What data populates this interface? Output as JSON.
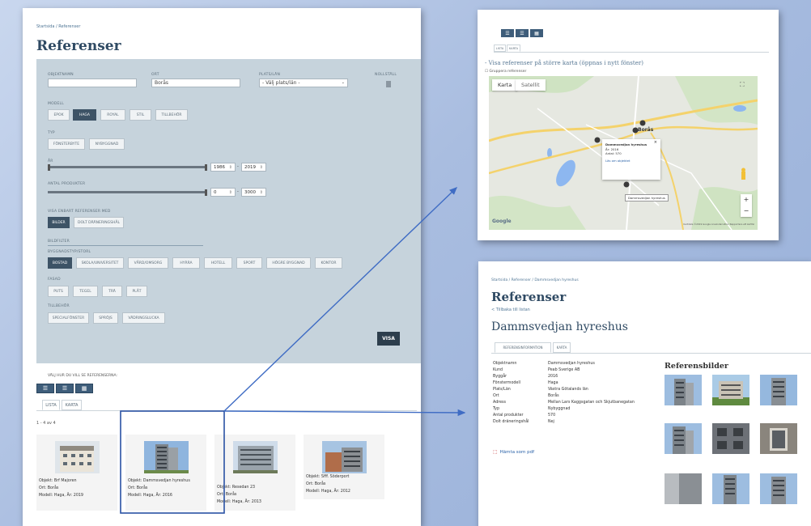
{
  "left": {
    "breadcrumb": "Startsida / Referenser",
    "title": "Referenser",
    "filter": {
      "objektnamn_label": "OBJEKTNAMN",
      "objektnamn_value": "",
      "ort_label": "ORT",
      "ort_value": "Borås",
      "plats_label": "PLATS/LÄN",
      "plats_value": "- Välj plats/län -",
      "nollstall_label": "NOLLSTÄLL",
      "modell_label": "MODELL",
      "modell": [
        "EPOK",
        "HAGA",
        "ROYAL",
        "STIL",
        "TILLBEHÖR"
      ],
      "typ_label": "TYP",
      "typ": [
        "FÖNSTERBYTE",
        "NYBYGGNAD"
      ],
      "ar_label": "ÅR",
      "ar_from": "1986",
      "ar_to": "2019",
      "antal_label": "ANTAL PRODUKTER",
      "antal_from": "0",
      "antal_to": "3000",
      "visa_enbart_label": "VISA ENBART REFERENSER MED",
      "visa_enbart": [
        "BILDER",
        "DOLT DRÄNERINGSHÅL"
      ],
      "bildfilter_label": "BILDFILTER",
      "byggnadsstorlek_label": "BYGGNADSTYP/STORL",
      "byggnadstyp": [
        "BOSTAD",
        "SKOLA/UNIVERSITET",
        "VÅRD/OMSORG",
        "HYRRA",
        "HOTELL",
        "SPORT",
        "HÖGRE BYGGNAD",
        "KONTOR"
      ],
      "fasad_label": "FASAD",
      "fasad": [
        "PUTS",
        "TEGEL",
        "TRÄ",
        "PLÅT"
      ],
      "tillbehor_label": "TILLBEHÖR",
      "tillbehor": [
        "SPECIALFÖNSTER",
        "SPRÖJS",
        "VÄDRINGSLUCKA"
      ],
      "visa_button": "VISA"
    },
    "view_label": "VÄLJ HUR DU VILL SE REFERENSERNA:",
    "tabs": [
      "LISTA",
      "KARTA"
    ],
    "count": "1 - 4 av 4",
    "cards": [
      {
        "objekt": "Objekt: Brf Majoren",
        "ort": "Ort: Borås",
        "modell": "Modell: Haga, År: 2019"
      },
      {
        "objekt": "Objekt: Dammsvedjan hyreshus",
        "ort": "Ort: Borås",
        "modell": "Modell: Haga, År: 2016"
      },
      {
        "objekt": "Objekt: Resedan 23",
        "ort": "Ort: Borås",
        "modell": "Modell: Haga, År: 2013"
      },
      {
        "objekt": "Objekt: Sfff. Söderport",
        "ort": "Ort: Borås",
        "modell": "Modell: Haga, År: 2012"
      }
    ]
  },
  "map_panel": {
    "tabs": [
      "LISTA",
      "KARTA"
    ],
    "link": "- Visa referenser på större karta (öppnas i nytt fönster)",
    "checkbox": "Gruppera referenser",
    "map_type": [
      "Karta",
      "Satellit"
    ],
    "city_label": "Borås",
    "popup": {
      "title": "Dammsvedjan hyreshus",
      "year": "År: 2016",
      "count": "Antal: 570",
      "link": "Läs om objektet"
    },
    "tooltip": "Dammsvedjan hyreshus",
    "google": "Google",
    "footer": "Kartdata ©2019 Google   Användarvillkor   Rapportera ett kartfel"
  },
  "detail_panel": {
    "breadcrumb": "Startsida / Referenser / Dammsvedjan hyreshus",
    "title": "Referenser",
    "back": "< Tillbaka till listan",
    "project": "Dammsvedjan hyreshus",
    "tabs": [
      "REFERENSINFORMATION",
      "KARTA"
    ],
    "info": [
      {
        "k": "Objektnamn",
        "v": "Dammsvedjan hyreshus"
      },
      {
        "k": "Kund",
        "v": "Peab Sverige AB"
      },
      {
        "k": "Byggår",
        "v": "2016"
      },
      {
        "k": "Fönstermodell",
        "v": "Haga"
      },
      {
        "k": "Plats/Län",
        "v": "Västra Götalands län"
      },
      {
        "k": "Ort",
        "v": "Borås"
      },
      {
        "k": "Adress",
        "v": "Mellan Lars Kaggsgatan och Skjutbanegatan"
      },
      {
        "k": "Typ",
        "v": "Nybyggnad"
      },
      {
        "k": "Antal produkter",
        "v": "570"
      },
      {
        "k": "Dolt dräneringshål",
        "v": "Nej"
      }
    ],
    "pdf": "Hämta som pdf",
    "refbilder": "Referensbilder"
  },
  "colors": {
    "accent": "#3d5366",
    "filter_bg": "#c6d3dc",
    "title": "#2f4a63",
    "link": "#2a62a8",
    "connector": "#3f6cc4"
  }
}
